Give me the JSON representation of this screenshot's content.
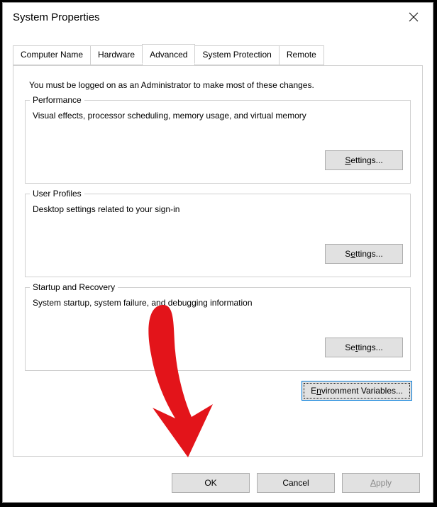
{
  "dialog": {
    "title": "System Properties",
    "closeName": "close-icon"
  },
  "tabs": {
    "items": [
      {
        "label": "Computer Name"
      },
      {
        "label": "Hardware"
      },
      {
        "label": "Advanced"
      },
      {
        "label": "System Protection"
      },
      {
        "label": "Remote"
      }
    ],
    "active_index": 2
  },
  "advanced": {
    "note": "You must be logged on as an Administrator to make most of these changes.",
    "performance": {
      "legend": "Performance",
      "desc": "Visual effects, processor scheduling, memory usage, and virtual memory",
      "button": "Settings..."
    },
    "userProfiles": {
      "legend": "User Profiles",
      "desc": "Desktop settings related to your sign-in",
      "button": "Settings..."
    },
    "startup": {
      "legend": "Startup and Recovery",
      "desc": "System startup, system failure, and debugging information",
      "button": "Settings..."
    },
    "envVars": "Environment Variables..."
  },
  "buttons": {
    "ok": "OK",
    "cancel": "Cancel",
    "apply": "Apply"
  }
}
